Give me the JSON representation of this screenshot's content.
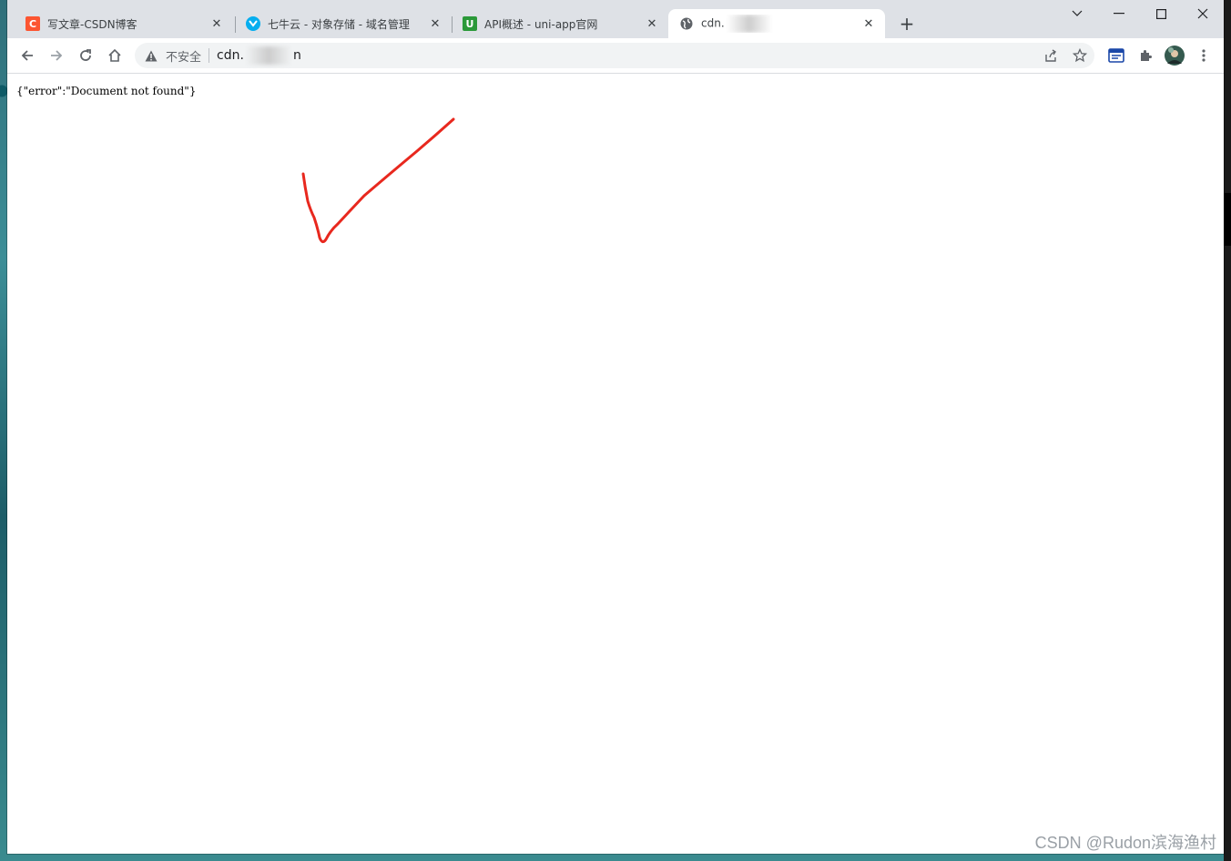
{
  "tabs": [
    {
      "title": "写文章-CSDN博客",
      "favicon": "csdn-icon",
      "favicon_text": "C",
      "favicon_color": "#fc5531"
    },
    {
      "title": "七牛云 - 对象存储 - 域名管理",
      "favicon": "qiniu-icon",
      "favicon_color": "#06aeef"
    },
    {
      "title": "API概述 - uni-app官网",
      "favicon": "uniapp-icon",
      "favicon_text": "U",
      "favicon_color": "#2b9939"
    },
    {
      "title": "cdn.",
      "favicon": "globe-icon",
      "active": true
    }
  ],
  "toolbar": {
    "security_label": "不安全",
    "url_prefix": "cdn.",
    "url_suffix": "n"
  },
  "content": {
    "text": "{\"error\":\"Document not found\"}",
    "annotation_color": "#e8281e"
  },
  "watermark": "CSDN @Rudon滨海渔村"
}
